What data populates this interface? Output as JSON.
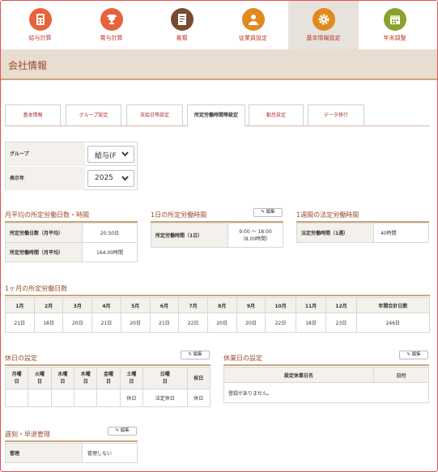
{
  "nav": [
    {
      "label": "給与計算",
      "icon": "calculator-icon",
      "color": "#e8623c"
    },
    {
      "label": "賞与計算",
      "icon": "trophy-icon",
      "color": "#e8623c"
    },
    {
      "label": "書類",
      "icon": "document-icon",
      "color": "#7a4a2e"
    },
    {
      "label": "従業員設定",
      "icon": "person-icon",
      "color": "#e08a1e"
    },
    {
      "label": "基本情報設定",
      "icon": "gear-icon",
      "color": "#e08a1e"
    },
    {
      "label": "年末調整",
      "icon": "calendar-icon",
      "color": "#8aa12e"
    }
  ],
  "page_title": "会社情報",
  "tabs": [
    "基本情報",
    "グループ設定",
    "支給日等設定",
    "所定労働時間等設定",
    "勤怠設定",
    "データ移行"
  ],
  "form": {
    "group_label": "グループ",
    "group_value": "給与(F",
    "year_label": "表示年",
    "year_value": "2025"
  },
  "monthly_avg": {
    "title": "月平均の所定労働日数・時間",
    "rows": [
      {
        "label": "所定労働日数（月平均）",
        "value": "20.50日"
      },
      {
        "label": "所定労働時間（月平均）",
        "value": "164.00時間"
      }
    ]
  },
  "daily": {
    "title": "1日の所定労働時間",
    "edit": "編集",
    "label": "所定労働時間（1日）",
    "value_line1": "9:00 ～ 18:00",
    "value_line2": "（8.00時間）"
  },
  "weekly": {
    "title": "1週間の法定労働時間",
    "label": "法定労働時間（1週）",
    "value": "40時間"
  },
  "monthly_days": {
    "title": "1ヶ月の所定労働日数",
    "headers": [
      "1月",
      "2月",
      "3月",
      "4月",
      "5月",
      "6月",
      "7月",
      "8月",
      "9月",
      "10月",
      "11月",
      "12月",
      "年間合計日数"
    ],
    "values": [
      "21日",
      "18日",
      "20日",
      "21日",
      "20日",
      "21日",
      "22日",
      "20日",
      "20日",
      "22日",
      "18日",
      "23日",
      "246日"
    ]
  },
  "holiday": {
    "title": "休日の設定",
    "edit": "編集",
    "headers": [
      "月曜日",
      "火曜日",
      "水曜日",
      "木曜日",
      "金曜日",
      "土曜日",
      "日曜日",
      "祝日"
    ],
    "values": [
      "",
      "",
      "",
      "",
      "",
      "休日",
      "法定休日",
      "休日"
    ]
  },
  "business_holiday": {
    "title": "休業日の設定",
    "edit": "編集",
    "headers": [
      "設定休業日名",
      "日付"
    ],
    "empty": "登録がありません。"
  },
  "late": {
    "title": "遅刻・早退管理",
    "edit": "編集",
    "label": "管理",
    "value": "管理しない"
  }
}
